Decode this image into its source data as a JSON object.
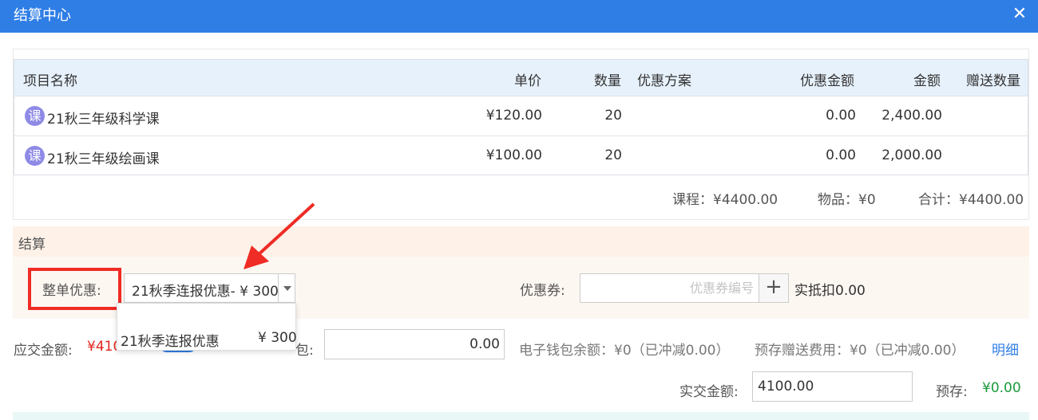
{
  "window": {
    "title": "结算中心",
    "close_icon": "close-icon"
  },
  "items_table": {
    "columns": [
      "项目名称",
      "单价",
      "数量",
      "优惠方案",
      "优惠金额",
      "金额",
      "赠送数量"
    ],
    "rows": [
      {
        "badge": "课",
        "name": "21秋三年级科学课",
        "price": "¥120.00",
        "qty": "20",
        "discount_plan": "",
        "discount_amount": "0.00",
        "amount": "2,400.00",
        "gift_qty": ""
      },
      {
        "badge": "课",
        "name": "21秋三年级绘画课",
        "price": "¥100.00",
        "qty": "20",
        "discount_plan": "",
        "discount_amount": "0.00",
        "amount": "2,000.00",
        "gift_qty": ""
      }
    ]
  },
  "summary": {
    "course": "课程：¥4400.00",
    "goods": "物品：¥0",
    "total": "合计：¥4400.00"
  },
  "settle": {
    "section_title": "结算",
    "order_discount_label": "整单优惠:",
    "order_discount_value": "21秋季连报优惠- ¥ 300",
    "coupon_label": "优惠券:",
    "coupon_placeholder": "优惠券编号",
    "coupon_deduct": "实抵扣0.00",
    "dropdown_options": [
      {
        "name": "21秋季连报优惠",
        "price": "¥ 300"
      }
    ]
  },
  "payment": {
    "due_label": "应交金额:",
    "due_value_visible": "¥410",
    "wallet_label_visible": "包:",
    "wallet_value": "0.00",
    "ewallet_balance": "电子钱包余额：¥0（已冲减0.00）",
    "prestore_gift": "预存赠送费用：¥0（已冲减0.00）",
    "detail_link": "明细",
    "paid_label": "实交金额:",
    "paid_value": "4100.00",
    "prestore_label": "预存:",
    "prestore_value": "¥0.00"
  },
  "colors": {
    "title_bar": "#2f7ee6",
    "header_bg": "#e7f1fc",
    "settle_bg": "#fdf1e8",
    "highlight": "#ef2c25",
    "due_red": "#e0271e",
    "green": "#1a9a3c",
    "link_blue": "#2f7ee6"
  }
}
